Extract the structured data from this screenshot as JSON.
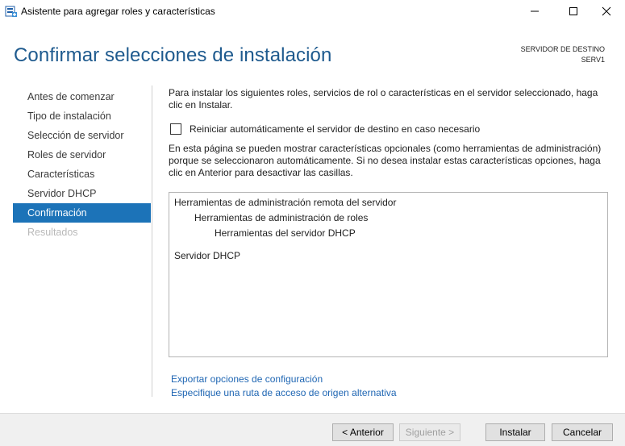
{
  "window": {
    "title": "Asistente para agregar roles y características"
  },
  "header": {
    "title": "Confirmar selecciones de instalación",
    "destination_label": "SERVIDOR DE DESTINO",
    "destination_server": "SERV1"
  },
  "nav": {
    "items": [
      {
        "label": "Antes de comenzar",
        "state": "normal"
      },
      {
        "label": "Tipo de instalación",
        "state": "normal"
      },
      {
        "label": "Selección de servidor",
        "state": "normal"
      },
      {
        "label": "Roles de servidor",
        "state": "normal"
      },
      {
        "label": "Características",
        "state": "normal"
      },
      {
        "label": "Servidor DHCP",
        "state": "normal"
      },
      {
        "label": "Confirmación",
        "state": "active"
      },
      {
        "label": "Resultados",
        "state": "disabled"
      }
    ]
  },
  "content": {
    "intro": "Para instalar los siguientes roles, servicios de rol o características en el servidor seleccionado, haga clic en Instalar.",
    "restart_checkbox": {
      "label": "Reiniciar automáticamente el servidor de destino en caso necesario",
      "checked": false
    },
    "note": "En esta página se pueden mostrar características opcionales (como herramientas de administración) porque se seleccionaron automáticamente. Si no desea instalar estas características opciones, haga clic en Anterior para desactivar las casillas.",
    "selection_items": [
      {
        "label": "Herramientas de administración remota del servidor",
        "level": 0
      },
      {
        "label": "Herramientas de administración de roles",
        "level": 1
      },
      {
        "label": "Herramientas del servidor DHCP",
        "level": 2
      },
      {
        "label": "Servidor DHCP",
        "level": 0
      }
    ]
  },
  "links": {
    "export": "Exportar opciones de configuración",
    "alternate_source": "Especifique una ruta de acceso de origen alternativa"
  },
  "footer": {
    "back": "< Anterior",
    "next": "Siguiente >",
    "install": "Instalar",
    "cancel": "Cancelar"
  },
  "colors": {
    "accent": "#1c73b8",
    "title": "#1e5a8e",
    "link": "#1f66b3"
  }
}
